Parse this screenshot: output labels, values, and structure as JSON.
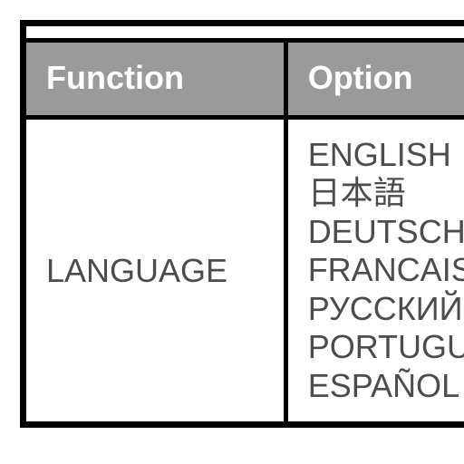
{
  "headers": {
    "function": "Function",
    "option": "Option"
  },
  "row": {
    "function": "LANGUAGE",
    "options": {
      "o0": "ENGLISH",
      "o1": "日本語",
      "o2": "DEUTSCH",
      "o3": "FRANCAIS",
      "o4": "РУССКИЙ",
      "o5": "PORTUGUÊS",
      "o6": "ESPAÑOL"
    }
  }
}
